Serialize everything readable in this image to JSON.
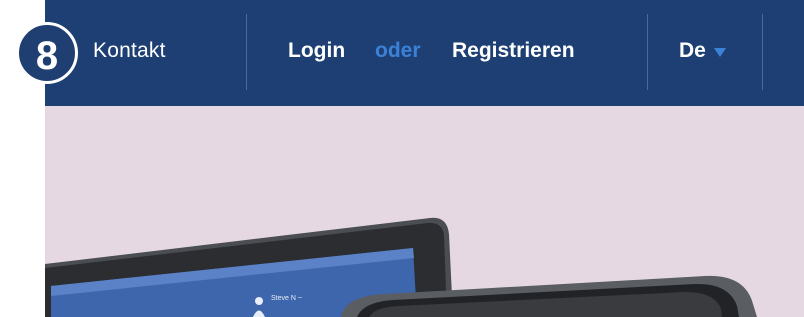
{
  "step_badge": "8",
  "nav": {
    "contact": "Kontakt",
    "login": "Login",
    "or": "oder",
    "register": "Registrieren",
    "language": "De"
  },
  "device_screen": {
    "user_label": "Steve N ~"
  },
  "colors": {
    "topbar": "#1d3f74",
    "accent": "#3b82d6",
    "hero_background": "#e5d8e2"
  }
}
